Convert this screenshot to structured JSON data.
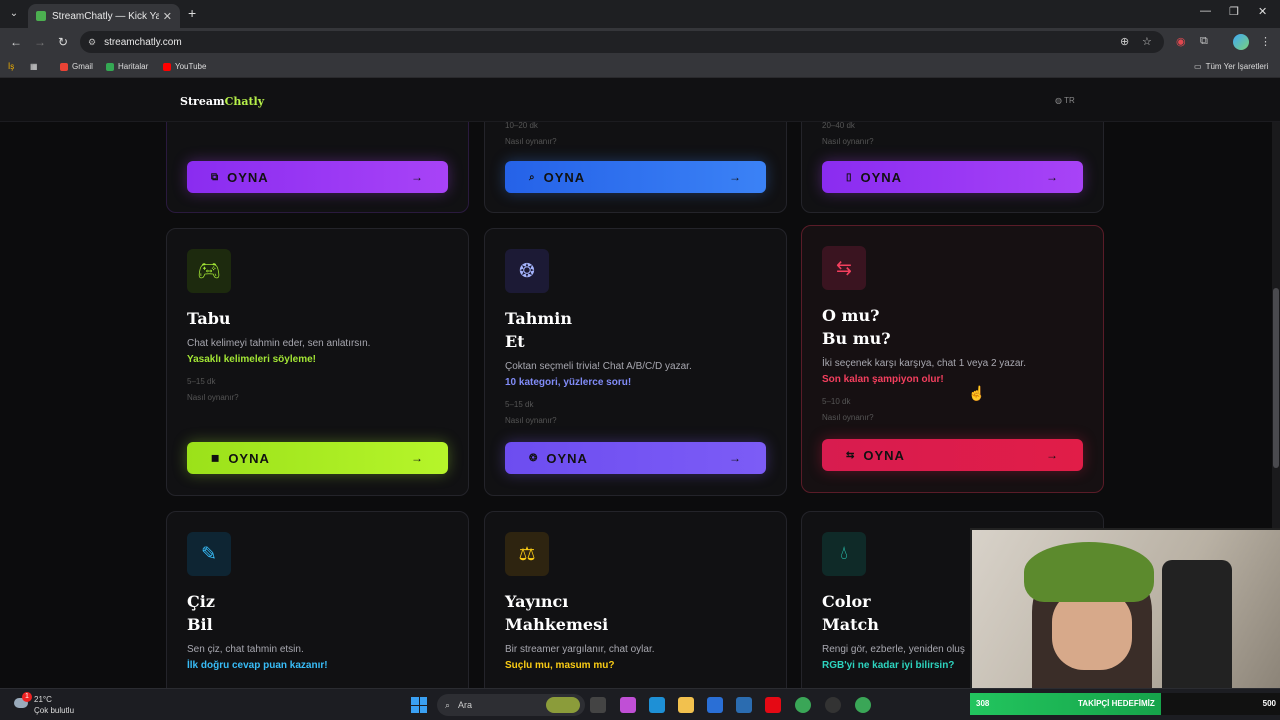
{
  "browser": {
    "tab_title": "StreamChatly — Kick Yayıncıları",
    "tab_close": "✕",
    "new_tab": "+",
    "url": "streamchatly.com",
    "bookmarks": [
      {
        "label": "Gmail",
        "color": "#ea4335"
      },
      {
        "label": "Haritalar",
        "color": "#34a853"
      },
      {
        "label": "YouTube",
        "color": "#ff0000"
      }
    ],
    "all_bookmarks": "Tüm Yer İşaretleri"
  },
  "site": {
    "logo_main": "Stream",
    "logo_accent": "Chatly",
    "language": "TR"
  },
  "top_cards": [
    {
      "meta1": "",
      "meta2": "",
      "button": "OYNA",
      "color": "purple"
    },
    {
      "meta1": "10–20 dk",
      "meta2": "Nasıl oynanır?",
      "button": "OYNA",
      "color": "blue"
    },
    {
      "meta1": "20–40 dk",
      "meta2": "Nasıl oynanır?",
      "button": "OYNA",
      "color": "purple"
    }
  ],
  "cards": [
    {
      "title_line1": "Tabu",
      "title_line2": "",
      "desc": "Chat kelimeyi tahmin eder, sen anlatırsın.",
      "highlight": "Yasaklı kelimeleri söyleme!",
      "highlight_color": "#a3e635",
      "duration": "5–15 dk",
      "howto": "Nasıl oynanır?",
      "button": "OYNA"
    },
    {
      "title_line1": "Tahmin",
      "title_line2": "Et",
      "desc": "Çoktan seçmeli trivia! Chat A/B/C/D yazar.",
      "highlight": "10 kategori, yüzlerce soru!",
      "highlight_color": "#818cf8",
      "duration": "5–15 dk",
      "howto": "Nasıl oynanır?",
      "button": "OYNA"
    },
    {
      "title_line1": "O mu?",
      "title_line2": "Bu mu?",
      "desc": "İki seçenek karşı karşıya, chat 1 veya 2 yazar.",
      "highlight": "Son kalan şampiyon olur!",
      "highlight_color": "#f43f5e",
      "duration": "5–10 dk",
      "howto": "Nasıl oynanır?",
      "button": "OYNA"
    },
    {
      "title_line1": "Çiz",
      "title_line2": "Bil",
      "desc": "Sen çiz, chat tahmin etsin.",
      "highlight": "İlk doğru cevap puan kazanır!",
      "highlight_color": "#38bdf8"
    },
    {
      "title_line1": "Yayıncı",
      "title_line2": "Mahkemesi",
      "desc": "Bir streamer yargılanır, chat oylar.",
      "highlight": "Suçlu mu, masum mu?",
      "highlight_color": "#facc15"
    },
    {
      "title_line1": "Color",
      "title_line2": "Match",
      "desc": "Rengi gör, ezberle, yeniden oluş",
      "highlight": "RGB'yi ne kadar iyi bilirsin?",
      "highlight_color": "#2dd4bf"
    }
  ],
  "overlay": {
    "count_left": "308",
    "goal_label": "TAKİPÇİ HEDEFİMİZ",
    "count_right": "500",
    "goal_progress": 0.616
  },
  "taskbar": {
    "temp": "21°C",
    "weather": "Çok bulutlu",
    "weather_badge": "1",
    "search_placeholder": "Ara"
  }
}
